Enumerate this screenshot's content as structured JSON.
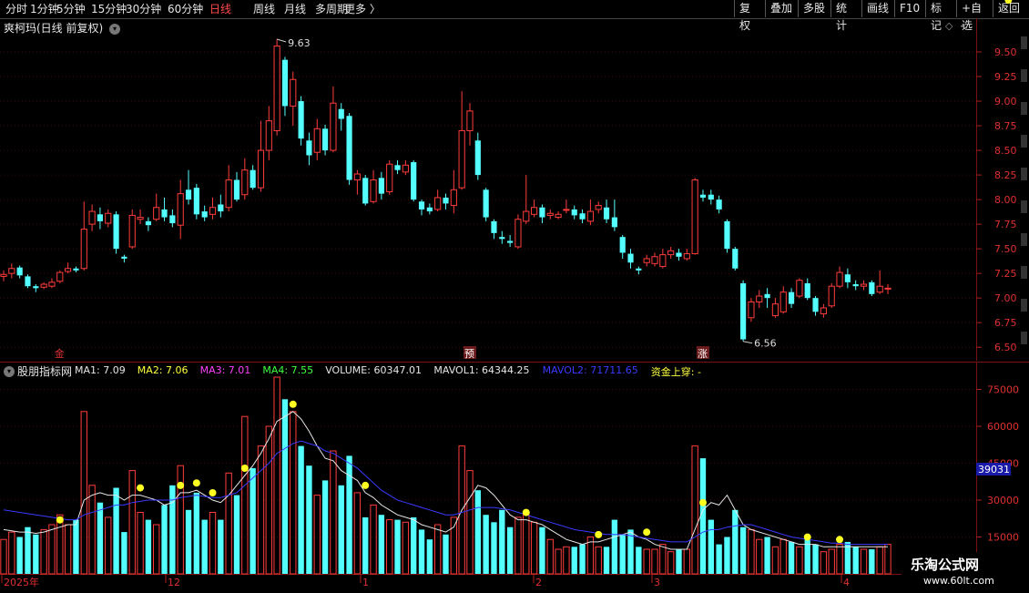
{
  "toolbar": {
    "periods": [
      {
        "label": "分时",
        "active": false
      },
      {
        "label": "1分钟",
        "active": false
      },
      {
        "label": "5分钟",
        "active": false
      },
      {
        "label": "15分钟",
        "active": false
      },
      {
        "label": "30分钟",
        "active": false
      },
      {
        "label": "60分钟",
        "active": false
      },
      {
        "label": "日线",
        "active": true
      },
      {
        "label": "周线",
        "active": false
      },
      {
        "label": "月线",
        "active": false
      },
      {
        "label": "多周期",
        "active": false
      },
      {
        "label": "更多",
        "active": false
      }
    ],
    "right_buttons": [
      "复权",
      "叠加",
      "多股",
      "统计",
      "画线",
      "F10",
      "标记",
      "+自选",
      "返回"
    ]
  },
  "main": {
    "title": "爽柯玛(日线 前复权)",
    "high_label": "9.63",
    "low_label": "6.56",
    "markers": [
      {
        "text": "金",
        "color": "#e03030"
      },
      {
        "text": "预",
        "color": "#e03030"
      },
      {
        "text": "涨",
        "color": "#e03030"
      }
    ],
    "price_ticks": [
      "9.50",
      "9.25",
      "9.00",
      "8.75",
      "8.50",
      "8.25",
      "8.00",
      "7.75",
      "7.50",
      "7.25",
      "7.00",
      "6.75",
      "6.50"
    ]
  },
  "indicator": {
    "name": "股朋指标网",
    "legend": [
      {
        "label": "MA1:",
        "value": "7.09",
        "color": "#e6e6e6"
      },
      {
        "label": "MA2:",
        "value": "7.06",
        "color": "#ffff40"
      },
      {
        "label": "MA3:",
        "value": "7.01",
        "color": "#ff40ff"
      },
      {
        "label": "MA4:",
        "value": "7.55",
        "color": "#40ff40"
      },
      {
        "label": "VOLUME:",
        "value": "60347.01",
        "color": "#e6e6e6"
      },
      {
        "label": "MAVOL1:",
        "value": "64344.25",
        "color": "#e6e6e6"
      },
      {
        "label": "MAVOL2:",
        "value": "71711.65",
        "color": "#3a3aff"
      },
      {
        "label": "资金上穿:",
        "value": "-",
        "color": "#ffff40"
      }
    ],
    "vol_ticks": [
      "75000",
      "60000",
      "45000",
      "30000",
      "15000"
    ],
    "current_vol_badge": "39031"
  },
  "date_axis": {
    "labels": [
      "2025年",
      "12",
      "1",
      "2",
      "3",
      "4"
    ]
  },
  "watermark": {
    "line1": "乐淘公式网",
    "line2": "www.60lt.com"
  },
  "chart_data": {
    "type": "candlestick",
    "y_range": [
      6.4,
      9.75
    ],
    "candles": [
      [
        7.22,
        7.24,
        7.28,
        7.17
      ],
      [
        7.25,
        7.3,
        7.35,
        7.2
      ],
      [
        7.31,
        7.23,
        7.33,
        7.2
      ],
      [
        7.22,
        7.12,
        7.24,
        7.1
      ],
      [
        7.12,
        7.1,
        7.14,
        7.06
      ],
      [
        7.11,
        7.14,
        7.16,
        7.09
      ],
      [
        7.12,
        7.16,
        7.2,
        7.1
      ],
      [
        7.17,
        7.26,
        7.28,
        7.15
      ],
      [
        7.27,
        7.3,
        7.36,
        7.25
      ],
      [
        7.3,
        7.28,
        7.32,
        7.26
      ],
      [
        7.3,
        7.7,
        7.98,
        7.28
      ],
      [
        7.75,
        7.88,
        7.95,
        7.68
      ],
      [
        7.85,
        7.78,
        7.92,
        7.7
      ],
      [
        7.76,
        7.86,
        7.9,
        7.72
      ],
      [
        7.85,
        7.5,
        7.88,
        7.45
      ],
      [
        7.42,
        7.4,
        7.44,
        7.36
      ],
      [
        7.52,
        7.84,
        7.9,
        7.5
      ],
      [
        7.8,
        7.82,
        7.9,
        7.75
      ],
      [
        7.78,
        7.74,
        7.82,
        7.68
      ],
      [
        7.8,
        7.92,
        8.06,
        7.78
      ],
      [
        7.9,
        7.82,
        8.02,
        7.78
      ],
      [
        7.84,
        7.76,
        7.9,
        7.72
      ],
      [
        7.74,
        8.06,
        8.2,
        7.6
      ],
      [
        8.1,
        8.0,
        8.3,
        7.95
      ],
      [
        8.12,
        7.85,
        8.16,
        7.8
      ],
      [
        7.88,
        7.82,
        7.94,
        7.78
      ],
      [
        7.85,
        7.92,
        8.02,
        7.8
      ],
      [
        7.95,
        7.88,
        8.05,
        7.82
      ],
      [
        7.92,
        8.2,
        8.35,
        7.88
      ],
      [
        8.2,
        8.0,
        8.28,
        7.98
      ],
      [
        8.05,
        8.3,
        8.42,
        8.0
      ],
      [
        8.3,
        8.12,
        8.35,
        8.1
      ],
      [
        8.12,
        8.5,
        8.8,
        8.08
      ],
      [
        8.5,
        8.8,
        8.95,
        8.4
      ],
      [
        8.7,
        9.56,
        9.63,
        8.65
      ],
      [
        9.42,
        8.95,
        9.45,
        8.85
      ],
      [
        8.95,
        9.22,
        9.3,
        8.75
      ],
      [
        9.0,
        8.62,
        9.05,
        8.55
      ],
      [
        8.6,
        8.45,
        8.68,
        8.35
      ],
      [
        8.48,
        8.72,
        8.82,
        8.4
      ],
      [
        8.72,
        8.5,
        8.76,
        8.45
      ],
      [
        8.5,
        8.98,
        9.15,
        8.48
      ],
      [
        8.92,
        8.82,
        8.98,
        8.7
      ],
      [
        8.85,
        8.2,
        8.88,
        8.15
      ],
      [
        8.2,
        8.26,
        8.3,
        8.05
      ],
      [
        8.22,
        7.96,
        8.25,
        7.94
      ],
      [
        7.98,
        8.2,
        8.3,
        7.96
      ],
      [
        8.22,
        8.06,
        8.28,
        8.0
      ],
      [
        8.08,
        8.36,
        8.4,
        8.05
      ],
      [
        8.35,
        8.3,
        8.4,
        8.26
      ],
      [
        8.28,
        8.35,
        8.4,
        8.25
      ],
      [
        8.38,
        8.0,
        8.4,
        7.98
      ],
      [
        7.98,
        7.9,
        8.0,
        7.84
      ],
      [
        7.92,
        7.88,
        7.96,
        7.85
      ],
      [
        7.9,
        8.02,
        8.1,
        7.88
      ],
      [
        8.02,
        7.96,
        8.06,
        7.9
      ],
      [
        7.94,
        8.1,
        8.3,
        7.86
      ],
      [
        8.12,
        8.7,
        9.1,
        8.1
      ],
      [
        8.7,
        8.9,
        8.98,
        8.55
      ],
      [
        8.6,
        8.25,
        8.68,
        8.2
      ],
      [
        8.1,
        7.82,
        8.12,
        7.78
      ],
      [
        7.78,
        7.66,
        7.8,
        7.6
      ],
      [
        7.62,
        7.6,
        7.68,
        7.55
      ],
      [
        7.58,
        7.56,
        7.64,
        7.52
      ],
      [
        7.52,
        7.8,
        7.85,
        7.5
      ],
      [
        7.78,
        7.88,
        8.25,
        7.75
      ],
      [
        7.85,
        7.92,
        8.0,
        7.82
      ],
      [
        7.92,
        7.82,
        7.95,
        7.76
      ],
      [
        7.84,
        7.86,
        7.9,
        7.8
      ],
      [
        7.82,
        7.85,
        7.88,
        7.8
      ],
      [
        7.9,
        7.9,
        8.0,
        7.86
      ],
      [
        7.9,
        7.84,
        7.94,
        7.8
      ],
      [
        7.86,
        7.8,
        7.9,
        7.76
      ],
      [
        7.78,
        7.88,
        8.0,
        7.74
      ],
      [
        7.9,
        7.94,
        7.98,
        7.86
      ],
      [
        7.92,
        7.8,
        8.0,
        7.76
      ],
      [
        7.82,
        7.72,
        8.0,
        7.68
      ],
      [
        7.62,
        7.46,
        7.64,
        7.4
      ],
      [
        7.45,
        7.36,
        7.5,
        7.3
      ],
      [
        7.3,
        7.28,
        7.32,
        7.24
      ],
      [
        7.36,
        7.4,
        7.44,
        7.32
      ],
      [
        7.35,
        7.42,
        7.46,
        7.32
      ],
      [
        7.32,
        7.44,
        7.5,
        7.3
      ],
      [
        7.44,
        7.48,
        7.52,
        7.4
      ],
      [
        7.46,
        7.42,
        7.5,
        7.38
      ],
      [
        7.4,
        7.45,
        7.5,
        7.38
      ],
      [
        7.45,
        8.2,
        8.22,
        7.44
      ],
      [
        8.05,
        8.02,
        8.1,
        7.98
      ],
      [
        8.05,
        8.0,
        8.1,
        7.95
      ],
      [
        8.0,
        7.9,
        8.04,
        7.86
      ],
      [
        7.78,
        7.5,
        7.8,
        7.46
      ],
      [
        7.5,
        7.3,
        7.52,
        7.28
      ],
      [
        7.15,
        6.58,
        7.18,
        6.56
      ],
      [
        6.8,
        6.96,
        7.0,
        6.76
      ],
      [
        6.96,
        7.02,
        7.08,
        6.9
      ],
      [
        7.04,
        7.0,
        7.1,
        6.9
      ],
      [
        6.82,
        6.94,
        7.0,
        6.8
      ],
      [
        6.86,
        7.06,
        7.12,
        6.84
      ],
      [
        7.06,
        6.94,
        7.1,
        6.9
      ],
      [
        7.02,
        7.18,
        7.2,
        7.0
      ],
      [
        7.15,
        7.0,
        7.2,
        6.98
      ],
      [
        7.0,
        6.86,
        7.02,
        6.82
      ],
      [
        6.84,
        6.9,
        6.94,
        6.8
      ],
      [
        6.92,
        7.12,
        7.15,
        6.9
      ],
      [
        7.12,
        7.26,
        7.32,
        7.1
      ],
      [
        7.24,
        7.16,
        7.3,
        7.1
      ],
      [
        7.14,
        7.12,
        7.18,
        7.08
      ],
      [
        7.12,
        7.14,
        7.18,
        7.08
      ],
      [
        7.16,
        7.04,
        7.18,
        7.02
      ],
      [
        7.06,
        7.12,
        7.28,
        7.04
      ],
      [
        7.1,
        7.1,
        7.14,
        7.04
      ]
    ],
    "volume_range": [
      0,
      80000
    ],
    "volumes": [
      14000,
      17000,
      15000,
      19000,
      16000,
      18000,
      20000,
      24000,
      20000,
      22000,
      66000,
      36000,
      29000,
      23000,
      35000,
      17000,
      42000,
      25000,
      22000,
      20000,
      28000,
      36000,
      44000,
      26000,
      33000,
      22000,
      25000,
      22000,
      41000,
      32000,
      64000,
      43000,
      52000,
      60000,
      80000,
      71000,
      66000,
      52000,
      44000,
      32000,
      38000,
      50000,
      36000,
      48000,
      33000,
      23000,
      28000,
      24000,
      22000,
      22000,
      21000,
      23000,
      18000,
      14000,
      20000,
      16000,
      23000,
      52000,
      42000,
      34000,
      24000,
      21000,
      26000,
      19000,
      23000,
      25000,
      21000,
      19000,
      14000,
      10000,
      11000,
      11000,
      12000,
      15000,
      11000,
      11000,
      22000,
      16000,
      18000,
      11000,
      10000,
      10000,
      12000,
      9000,
      10000,
      10000,
      52000,
      47000,
      22000,
      12000,
      15000,
      26000,
      19000,
      18000,
      14000,
      15000,
      11000,
      14000,
      13000,
      11000,
      14000,
      12000,
      9000,
      10000,
      12000,
      13000,
      11000,
      10000,
      10000,
      11000,
      12000
    ],
    "mavol1": [
      18000,
      17500,
      17000,
      17000,
      16500,
      17000,
      18000,
      19000,
      20000,
      20000,
      30000,
      32000,
      33000,
      32000,
      32000,
      30000,
      32000,
      32000,
      31000,
      30000,
      28000,
      29000,
      33000,
      33000,
      34000,
      32000,
      30000,
      29000,
      32000,
      36000,
      40000,
      44000,
      49000,
      55000,
      62000,
      64000,
      66000,
      63000,
      58000,
      52000,
      47000,
      46000,
      42000,
      40000,
      38000,
      33000,
      31000,
      28000,
      26000,
      24000,
      23000,
      22000,
      20000,
      19000,
      18000,
      17000,
      19000,
      26000,
      31000,
      36000,
      35000,
      32000,
      28000,
      24000,
      22000,
      22000,
      21000,
      20000,
      18000,
      16000,
      14000,
      13000,
      12000,
      13000,
      13000,
      14000,
      15000,
      16000,
      17000,
      15000,
      14000,
      12000,
      11000,
      10000,
      10000,
      10000,
      18000,
      26000,
      29000,
      28000,
      32000,
      26000,
      20000,
      18000,
      17000,
      16000,
      15000,
      14000,
      13000,
      12000,
      12000,
      12000,
      11000,
      11000,
      11000,
      11000,
      11000,
      11000,
      11000,
      11000,
      11000
    ],
    "mavol2": [
      26000,
      25500,
      25000,
      24500,
      24000,
      23500,
      23000,
      22500,
      22000,
      22000,
      24000,
      25000,
      26000,
      27000,
      28000,
      28000,
      29000,
      29500,
      30000,
      30000,
      30000,
      30000,
      31000,
      31500,
      32000,
      31500,
      31000,
      31000,
      32000,
      33000,
      36000,
      39000,
      42000,
      45000,
      49000,
      51000,
      53000,
      54000,
      53000,
      52000,
      50000,
      49000,
      47000,
      45000,
      43000,
      40000,
      37000,
      34000,
      32000,
      30000,
      29000,
      28000,
      27000,
      26000,
      25000,
      24000,
      24000,
      25000,
      26000,
      27000,
      27000,
      27000,
      26500,
      26000,
      25000,
      24000,
      23000,
      22000,
      21000,
      20000,
      19000,
      18000,
      17500,
      17000,
      16500,
      16000,
      16000,
      16000,
      15500,
      15000,
      14500,
      14000,
      13500,
      13000,
      13000,
      13000,
      15000,
      17000,
      18000,
      18000,
      19000,
      19500,
      20000,
      20000,
      19000,
      18000,
      17000,
      16000,
      15000,
      14500,
      14000,
      13500,
      13000,
      12500,
      12500,
      12000,
      12000,
      12000,
      12000,
      12000,
      12000
    ],
    "signal_dots": [
      7,
      17,
      22,
      24,
      26,
      30,
      36,
      45,
      65,
      74,
      80,
      87,
      100,
      104,
      125
    ]
  }
}
